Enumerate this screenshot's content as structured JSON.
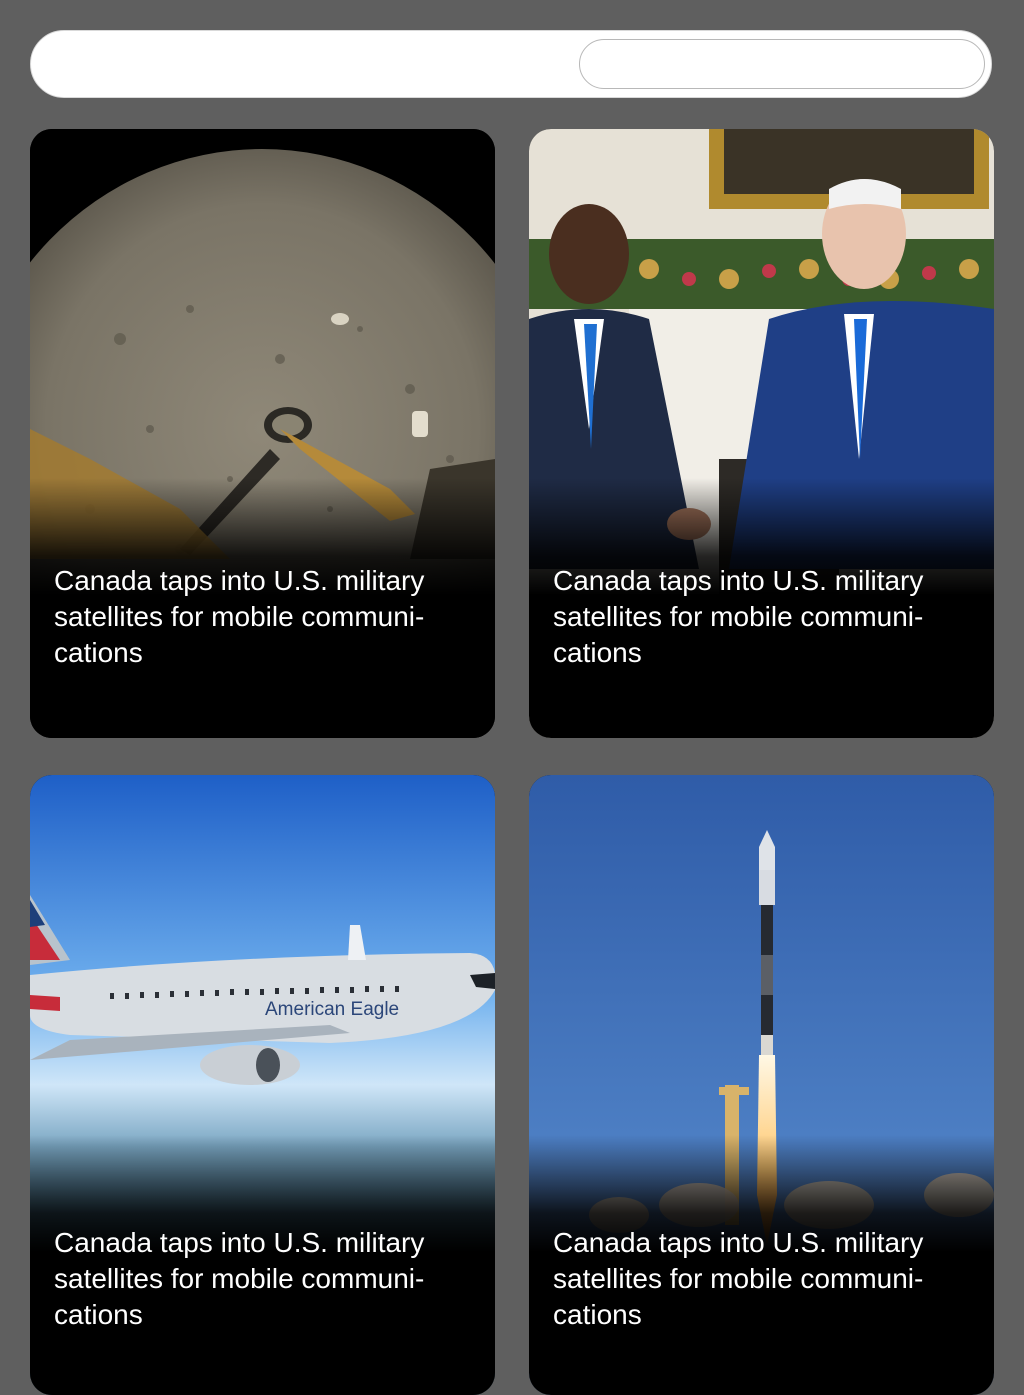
{
  "search": {
    "placeholder": ""
  },
  "cards": [
    {
      "headline": "Canada taps into U.S. military satellites for mobile communi-cations",
      "image": "lunar-surface-photo"
    },
    {
      "headline": "Canada taps into U.S. military satellites for mobile communi-cations",
      "image": "handshake-photo"
    },
    {
      "headline": "Canada taps into U.S. military satellites for mobile communi-cations",
      "image": "airplane-photo",
      "image_text": "American Eagle"
    },
    {
      "headline": "Canada taps into U.S. military satellites for mobile communi-cations",
      "image": "rocket-launch-photo"
    }
  ],
  "colors": {
    "background": "#5f5f5f",
    "card": "#000000",
    "headline": "#ffffff",
    "bar": "#ffffff"
  }
}
